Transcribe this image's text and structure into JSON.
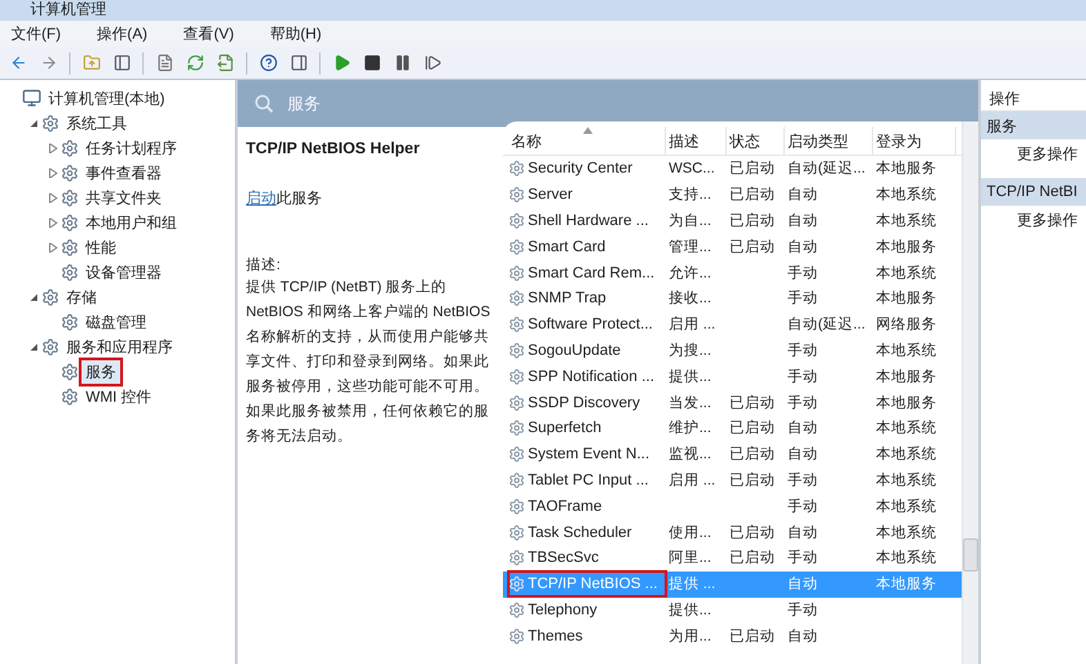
{
  "window": {
    "title": "计算机管理"
  },
  "menu": [
    "文件(F)",
    "操作(A)",
    "查看(V)",
    "帮助(H)"
  ],
  "tree": [
    {
      "label": "计算机管理(本地)",
      "selected": false,
      "children": [
        {
          "label": "系统工具",
          "expanded": true,
          "selected": false,
          "children": [
            {
              "label": "任务计划程序",
              "expanded": false,
              "selected": false
            },
            {
              "label": "事件查看器",
              "expanded": false,
              "selected": false
            },
            {
              "label": "共享文件夹",
              "expanded": false,
              "selected": false
            },
            {
              "label": "本地用户和组",
              "expanded": false,
              "selected": false
            },
            {
              "label": "性能",
              "expanded": false,
              "selected": false
            },
            {
              "label": "设备管理器",
              "selected": false
            }
          ]
        },
        {
          "label": "存储",
          "expanded": true,
          "selected": false,
          "children": [
            {
              "label": "磁盘管理",
              "selected": false
            }
          ]
        },
        {
          "label": "服务和应用程序",
          "expanded": true,
          "selected": false,
          "children": [
            {
              "label": "服务",
              "selected": true
            },
            {
              "label": "WMI 控件",
              "selected": false
            }
          ]
        }
      ]
    }
  ],
  "pane_title": "服务",
  "detail": {
    "title": "TCP/IP NetBIOS Helper",
    "start_link": "启动",
    "start_text": "此服务",
    "description_label": "描述:",
    "description": "提供 TCP/IP (NetBT) 服务上的 NetBIOS 和网络上客户端的 NetBIOS 名称解析的支持，从而使用户能够共享文件、打印和登录到网络。如果此服务被停用，这些功能可能不可用。如果此服务被禁用，任何依赖它的服务将无法启动。"
  },
  "table": {
    "columns": [
      "名称",
      "描述",
      "状态",
      "启动类型",
      "登录为"
    ],
    "rows": [
      {
        "name": "Security Center",
        "desc": "WSC...",
        "status": "已启动",
        "startup": "自动(延迟...",
        "logon": "本地服务",
        "selected": false
      },
      {
        "name": "Server",
        "desc": "支持...",
        "status": "已启动",
        "startup": "自动",
        "logon": "本地系统",
        "selected": false
      },
      {
        "name": "Shell Hardware ...",
        "desc": "为自...",
        "status": "已启动",
        "startup": "自动",
        "logon": "本地系统",
        "selected": false
      },
      {
        "name": "Smart Card",
        "desc": "管理...",
        "status": "已启动",
        "startup": "自动",
        "logon": "本地服务",
        "selected": false
      },
      {
        "name": "Smart Card Rem...",
        "desc": "允许...",
        "startup": "手动",
        "logon": "本地系统",
        "selected": false
      },
      {
        "name": "SNMP Trap",
        "desc": "接收...",
        "startup": "手动",
        "logon": "本地服务",
        "selected": false
      },
      {
        "name": "Software Protect...",
        "desc": "启用 ...",
        "startup": "自动(延迟...",
        "logon": "网络服务",
        "selected": false
      },
      {
        "name": "SogouUpdate",
        "desc": "为搜...",
        "startup": "手动",
        "logon": "本地系统",
        "selected": false
      },
      {
        "name": "SPP Notification ...",
        "desc": "提供...",
        "startup": "手动",
        "logon": "本地服务",
        "selected": false
      },
      {
        "name": "SSDP Discovery",
        "desc": "当发...",
        "status": "已启动",
        "startup": "手动",
        "logon": "本地服务",
        "selected": false
      },
      {
        "name": "Superfetch",
        "desc": "维护...",
        "status": "已启动",
        "startup": "自动",
        "logon": "本地系统",
        "selected": false
      },
      {
        "name": "System Event N...",
        "desc": "监视...",
        "status": "已启动",
        "startup": "自动",
        "logon": "本地系统",
        "selected": false
      },
      {
        "name": "Tablet PC Input ...",
        "desc": "启用 ...",
        "status": "已启动",
        "startup": "手动",
        "logon": "本地系统",
        "selected": false
      },
      {
        "name": "TAOFrame",
        "startup": "手动",
        "logon": "本地系统",
        "selected": false
      },
      {
        "name": "Task Scheduler",
        "desc": "使用...",
        "status": "已启动",
        "startup": "自动",
        "logon": "本地系统",
        "selected": false
      },
      {
        "name": "TBSecSvc",
        "desc": "阿里...",
        "status": "已启动",
        "startup": "手动",
        "logon": "本地系统",
        "selected": false
      },
      {
        "name": "TCP/IP NetBIOS ...",
        "desc": "提供 ...",
        "startup": "自动",
        "logon": "本地服务",
        "selected": true
      },
      {
        "name": "Telephony",
        "desc": "提供...",
        "startup": "手动",
        "selected": false
      },
      {
        "name": "Themes",
        "desc": "为用...",
        "status": "已启动",
        "startup": "自动",
        "selected": false
      }
    ]
  },
  "actions": {
    "title": "操作",
    "sections": [
      {
        "title": "服务",
        "items": [
          "更多操作"
        ]
      },
      {
        "title": "TCP/IP NetBI",
        "items": [
          "更多操作"
        ]
      }
    ]
  }
}
